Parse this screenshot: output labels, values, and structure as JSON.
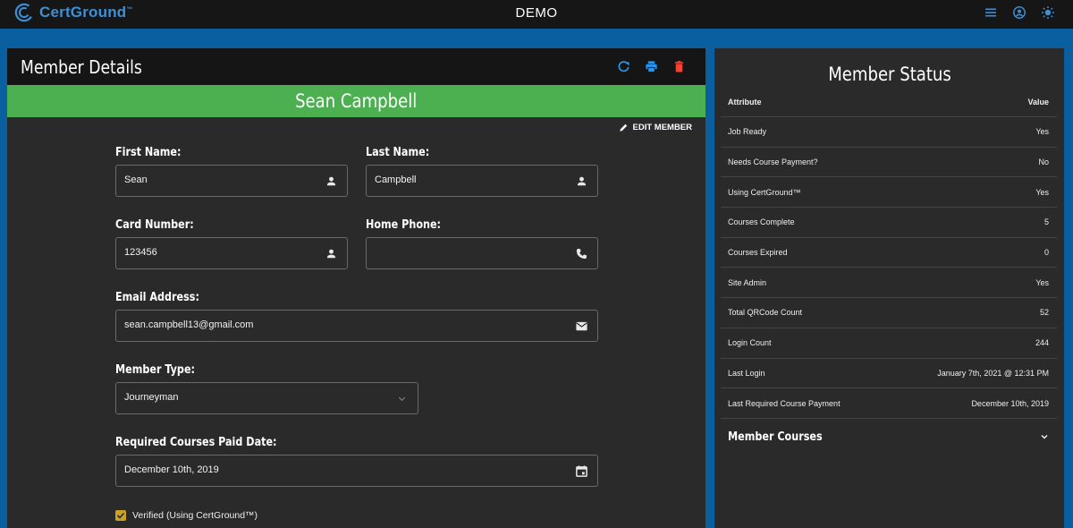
{
  "topbar": {
    "brand": "CertGround",
    "brand_tm": "™",
    "title": "DEMO",
    "icons": [
      "menu-icon",
      "account-circle-icon",
      "brightness-icon"
    ]
  },
  "member_details": {
    "title": "Member Details",
    "header_icons": [
      "refresh-icon",
      "print-icon",
      "delete-icon"
    ],
    "member_name": "Sean Campbell",
    "edit_label": "EDIT MEMBER",
    "fields": {
      "first_name": {
        "label": "First Name:",
        "value": "Sean",
        "icon": "person-icon"
      },
      "last_name": {
        "label": "Last Name:",
        "value": "Campbell",
        "icon": "person-icon"
      },
      "card_number": {
        "label": "Card Number:",
        "value": "123456",
        "icon": "person-icon"
      },
      "home_phone": {
        "label": "Home Phone:",
        "value": "",
        "icon": "phone-icon"
      },
      "email": {
        "label": "Email Address:",
        "value": "sean.campbell13@gmail.com",
        "icon": "mail-icon"
      },
      "member_type": {
        "label": "Member Type:",
        "value": "Journeyman",
        "icon": "chevron-down-icon"
      },
      "paid_date": {
        "label": "Required Courses Paid Date:",
        "value": "December 10th, 2019",
        "icon": "calendar-icon"
      }
    },
    "verified_label": "Verified (Using CertGround™)",
    "verified_checked": true
  },
  "member_status": {
    "title": "Member Status",
    "columns": {
      "attribute": "Attribute",
      "value": "Value"
    },
    "rows": [
      {
        "attribute": "Job Ready",
        "value": "Yes"
      },
      {
        "attribute": "Needs Course Payment?",
        "value": "No"
      },
      {
        "attribute": "Using CertGround™",
        "value": "Yes"
      },
      {
        "attribute": "Courses Complete",
        "value": "5"
      },
      {
        "attribute": "Courses Expired",
        "value": "0"
      },
      {
        "attribute": "Site Admin",
        "value": "Yes"
      },
      {
        "attribute": "Total QRCode Count",
        "value": "52"
      },
      {
        "attribute": "Login Count",
        "value": "244"
      },
      {
        "attribute": "Last Login",
        "value": "January 7th, 2021 @ 12:31 PM"
      },
      {
        "attribute": "Last Required Course Payment",
        "value": "December 10th, 2019"
      }
    ],
    "courses_label": "Member Courses"
  },
  "colors": {
    "page_background": "#0a5fa0",
    "topbar": "#161616",
    "panel": "#2a2a2a",
    "name_banner": "#4caf50",
    "accent_blue": "#2196f3",
    "delete_red": "#f44336",
    "checkbox": "#c9a227"
  }
}
